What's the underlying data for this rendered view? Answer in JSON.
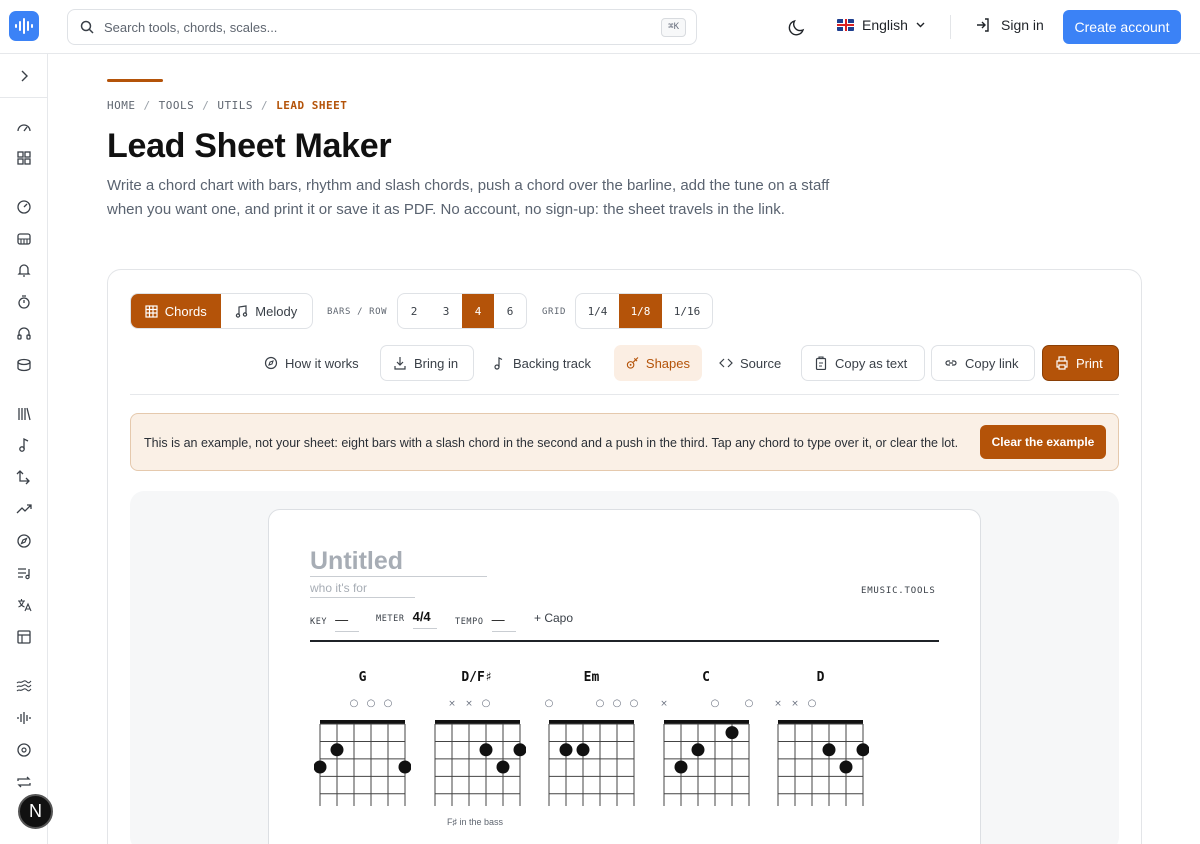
{
  "header": {
    "search_placeholder": "Search tools, chords, scales...",
    "shortcut": "⌘K",
    "language": "English",
    "sign_in": "Sign in",
    "create_account": "Create account"
  },
  "breadcrumb": [
    "HOME",
    "TOOLS",
    "UTILS",
    "LEAD SHEET"
  ],
  "breadcrumb_sep": "/",
  "page": {
    "title": "Lead Sheet Maker",
    "description": "Write a chord chart with bars, rhythm and slash chords, push a chord over the barline, add the tune on a staff when you want one, and print it or save it as PDF. No account, no sign-up: the sheet travels in the link."
  },
  "mode": {
    "chords": "Chords",
    "melody": "Melody",
    "active": "Chords"
  },
  "bars_per_row": {
    "label": "BARS / ROW",
    "options": [
      "2",
      "3",
      "4",
      "6"
    ],
    "selected": "4"
  },
  "grid": {
    "label": "GRID",
    "options": [
      "1/4",
      "1/8",
      "1/16"
    ],
    "selected": "1/8"
  },
  "toolbar": {
    "how_it_works": "How it works",
    "bring_in": "Bring in",
    "backing_track": "Backing track",
    "shapes": "Shapes",
    "source": "Source",
    "copy_as_text": "Copy as text",
    "copy_link": "Copy link",
    "print": "Print"
  },
  "notice": {
    "text": "This is an example, not your sheet: eight bars with a slash chord in the second and a push in the third. Tap any chord to type over it, or clear the lot.",
    "clear_button": "Clear the example"
  },
  "sheet": {
    "title_placeholder": "Untitled",
    "subtitle_placeholder": "who it's for",
    "brand": "EMUSIC.TOOLS",
    "key_label": "KEY",
    "key_value": "—",
    "meter_label": "METER",
    "meter_value": "4/4",
    "tempo_label": "TEMPO",
    "tempo_value": "—",
    "capo": "+ Capo",
    "bass_note": "F♯ in the bass"
  },
  "chords": [
    {
      "name": "G",
      "strings": [
        "",
        "",
        "o",
        "o",
        "o",
        ""
      ],
      "dots": [
        [
          1,
          2
        ],
        [
          0,
          3
        ],
        [
          5,
          3
        ]
      ]
    },
    {
      "name": "D/F♯",
      "strings": [
        "",
        "x",
        "x",
        "o",
        "",
        ""
      ],
      "dots": [
        [
          3,
          2
        ],
        [
          5,
          2
        ],
        [
          4,
          3
        ]
      ]
    },
    {
      "name": "Em",
      "strings": [
        "o",
        "",
        "",
        "o",
        "o",
        "o"
      ],
      "dots": [
        [
          1,
          2
        ],
        [
          2,
          2
        ]
      ]
    },
    {
      "name": "C",
      "strings": [
        "x",
        "",
        "",
        "o",
        "",
        "o"
      ],
      "dots": [
        [
          4,
          1
        ],
        [
          2,
          2
        ],
        [
          1,
          3
        ]
      ]
    },
    {
      "name": "D",
      "strings": [
        "x",
        "x",
        "o",
        "",
        "",
        ""
      ],
      "dots": [
        [
          3,
          2
        ],
        [
          5,
          2
        ],
        [
          4,
          3
        ]
      ]
    }
  ],
  "colors": {
    "accent": "#b45309",
    "primary": "#3b82f6",
    "notice_bg": "#faf0e6"
  }
}
